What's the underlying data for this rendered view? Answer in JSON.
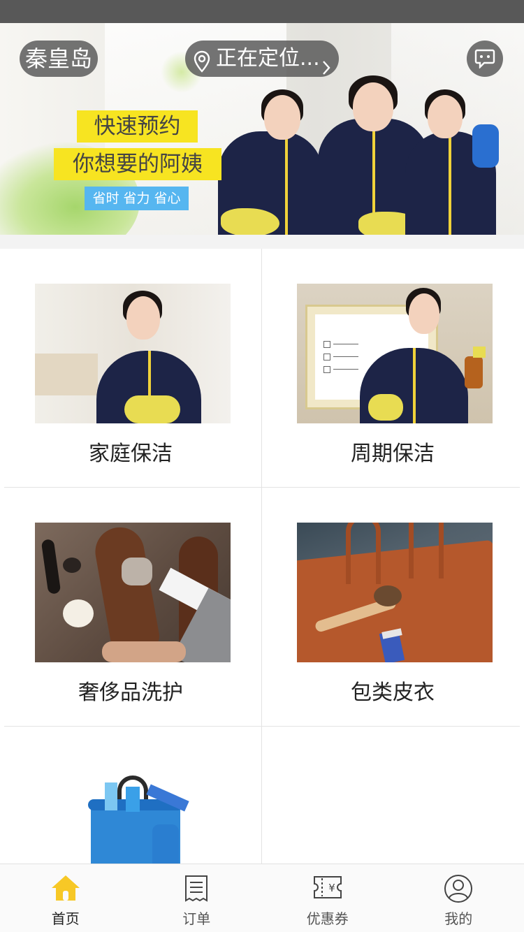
{
  "app": {
    "accent": "#f7c826",
    "slogan_yellow": "#f7e421",
    "slogan_blue": "#56b6f0"
  },
  "header": {
    "city": "秦皇岛",
    "location_status": "正在定位...",
    "location_icon": "location-pin-icon",
    "message_icon": "chat-bubble-icon"
  },
  "banner": {
    "line1": "快速预约",
    "line2": "你想要的阿姨",
    "line3": "省时 省力 省心"
  },
  "services": [
    {
      "label": "家庭保洁"
    },
    {
      "label": "周期保洁"
    },
    {
      "label": "奢侈品洗护"
    },
    {
      "label": "包类皮衣"
    },
    {
      "label": ""
    }
  ],
  "tabbar": {
    "items": [
      {
        "label": "首页",
        "icon": "home-icon",
        "active": true
      },
      {
        "label": "订单",
        "icon": "receipt-icon",
        "active": false
      },
      {
        "label": "优惠券",
        "icon": "coupon-icon",
        "active": false
      },
      {
        "label": "我的",
        "icon": "profile-icon",
        "active": false
      }
    ]
  }
}
